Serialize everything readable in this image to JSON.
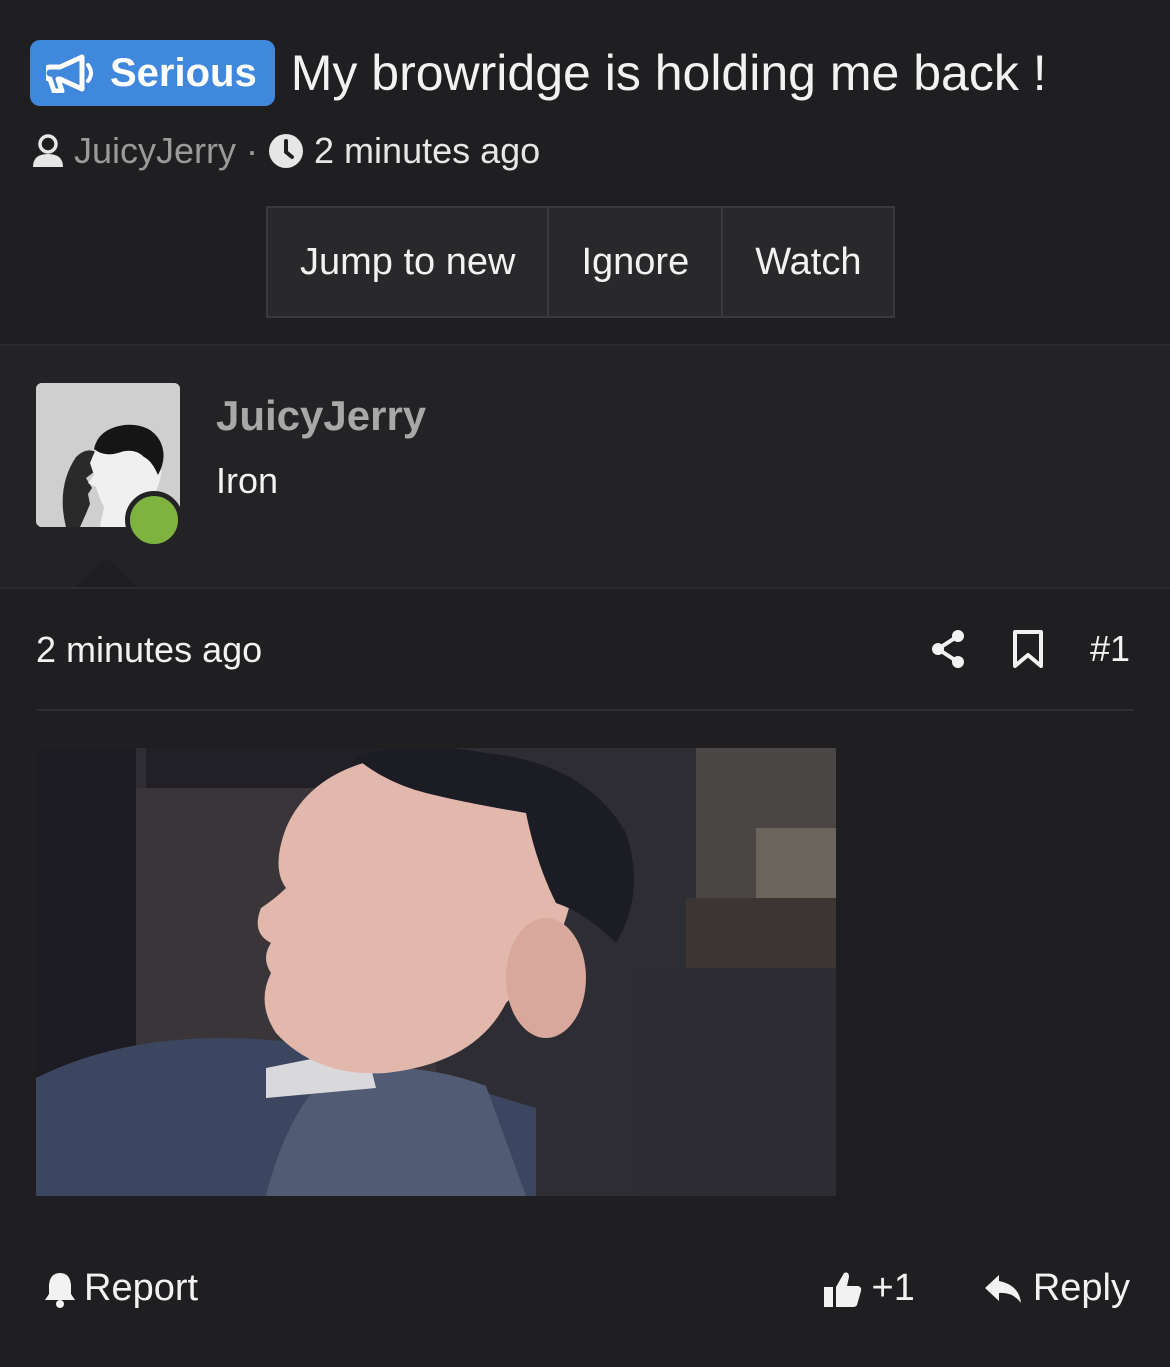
{
  "thread": {
    "prefix": "Serious",
    "title": "My browridge is holding me back !",
    "author": "JuicyJerry",
    "separator": "·",
    "time": "2 minutes ago"
  },
  "toolbar": {
    "jump_label": "Jump to new",
    "ignore_label": "Ignore",
    "watch_label": "Watch"
  },
  "post": {
    "username": "JuicyJerry",
    "user_title": "Iron",
    "online": true,
    "time": "2 minutes ago",
    "number": "#1",
    "image_alt": "side profile photo"
  },
  "footer": {
    "report_label": "Report",
    "like_count": "+1",
    "reply_label": "Reply"
  },
  "colors": {
    "background": "#1f1f21",
    "user_block": "#232325",
    "prefix_badge": "#3f88dc",
    "online": "#7db33f"
  },
  "icons": {
    "prefix": "megaphone-icon",
    "author": "user-icon",
    "time": "clock-icon",
    "share": "share-icon",
    "bookmark": "bookmark-icon",
    "report": "bell-icon",
    "like": "thumbs-up-icon",
    "reply": "reply-icon"
  }
}
